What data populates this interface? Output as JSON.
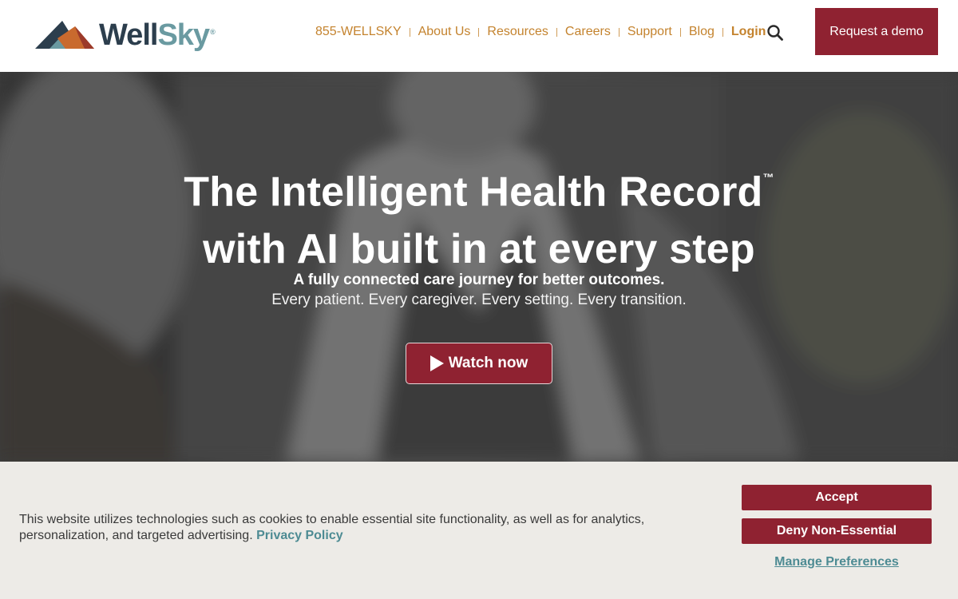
{
  "header": {
    "logo": {
      "text_well": "Well",
      "text_sky": "Sky",
      "reg": "®",
      "icon": "mountain-logo-icon"
    },
    "nav": [
      {
        "label": "855-WELLSKY",
        "bold": false
      },
      {
        "label": "About Us",
        "bold": false
      },
      {
        "label": "Resources",
        "bold": false
      },
      {
        "label": "Careers",
        "bold": false
      },
      {
        "label": "Support",
        "bold": false
      },
      {
        "label": "Blog",
        "bold": false
      },
      {
        "label": "Login",
        "bold": true
      }
    ],
    "search_icon": "search-icon",
    "demo_button": "Request a demo"
  },
  "hero": {
    "title_line1": "The Intelligent Health Record",
    "trademark": "™",
    "title_line2": "with AI built in at every step",
    "subtitle_strong": "A fully connected care journey for better outcomes.",
    "subtitle": "Every patient. Every caregiver. Every setting. Every transition.",
    "watch_button": "Watch now",
    "play_icon": "play-icon"
  },
  "cookie": {
    "text": "This website utilizes technologies such as cookies to enable essential site functionality, as well as for analytics, personalization, and targeted advertising.",
    "privacy_link": "Privacy Policy",
    "accept": "Accept",
    "deny": "Deny Non-Essential",
    "manage": "Manage Preferences"
  },
  "colors": {
    "brand_red": "#8f2231",
    "nav_orange": "#c4832e",
    "teal": "#4d8b93",
    "navy": "#2c3e4d"
  }
}
